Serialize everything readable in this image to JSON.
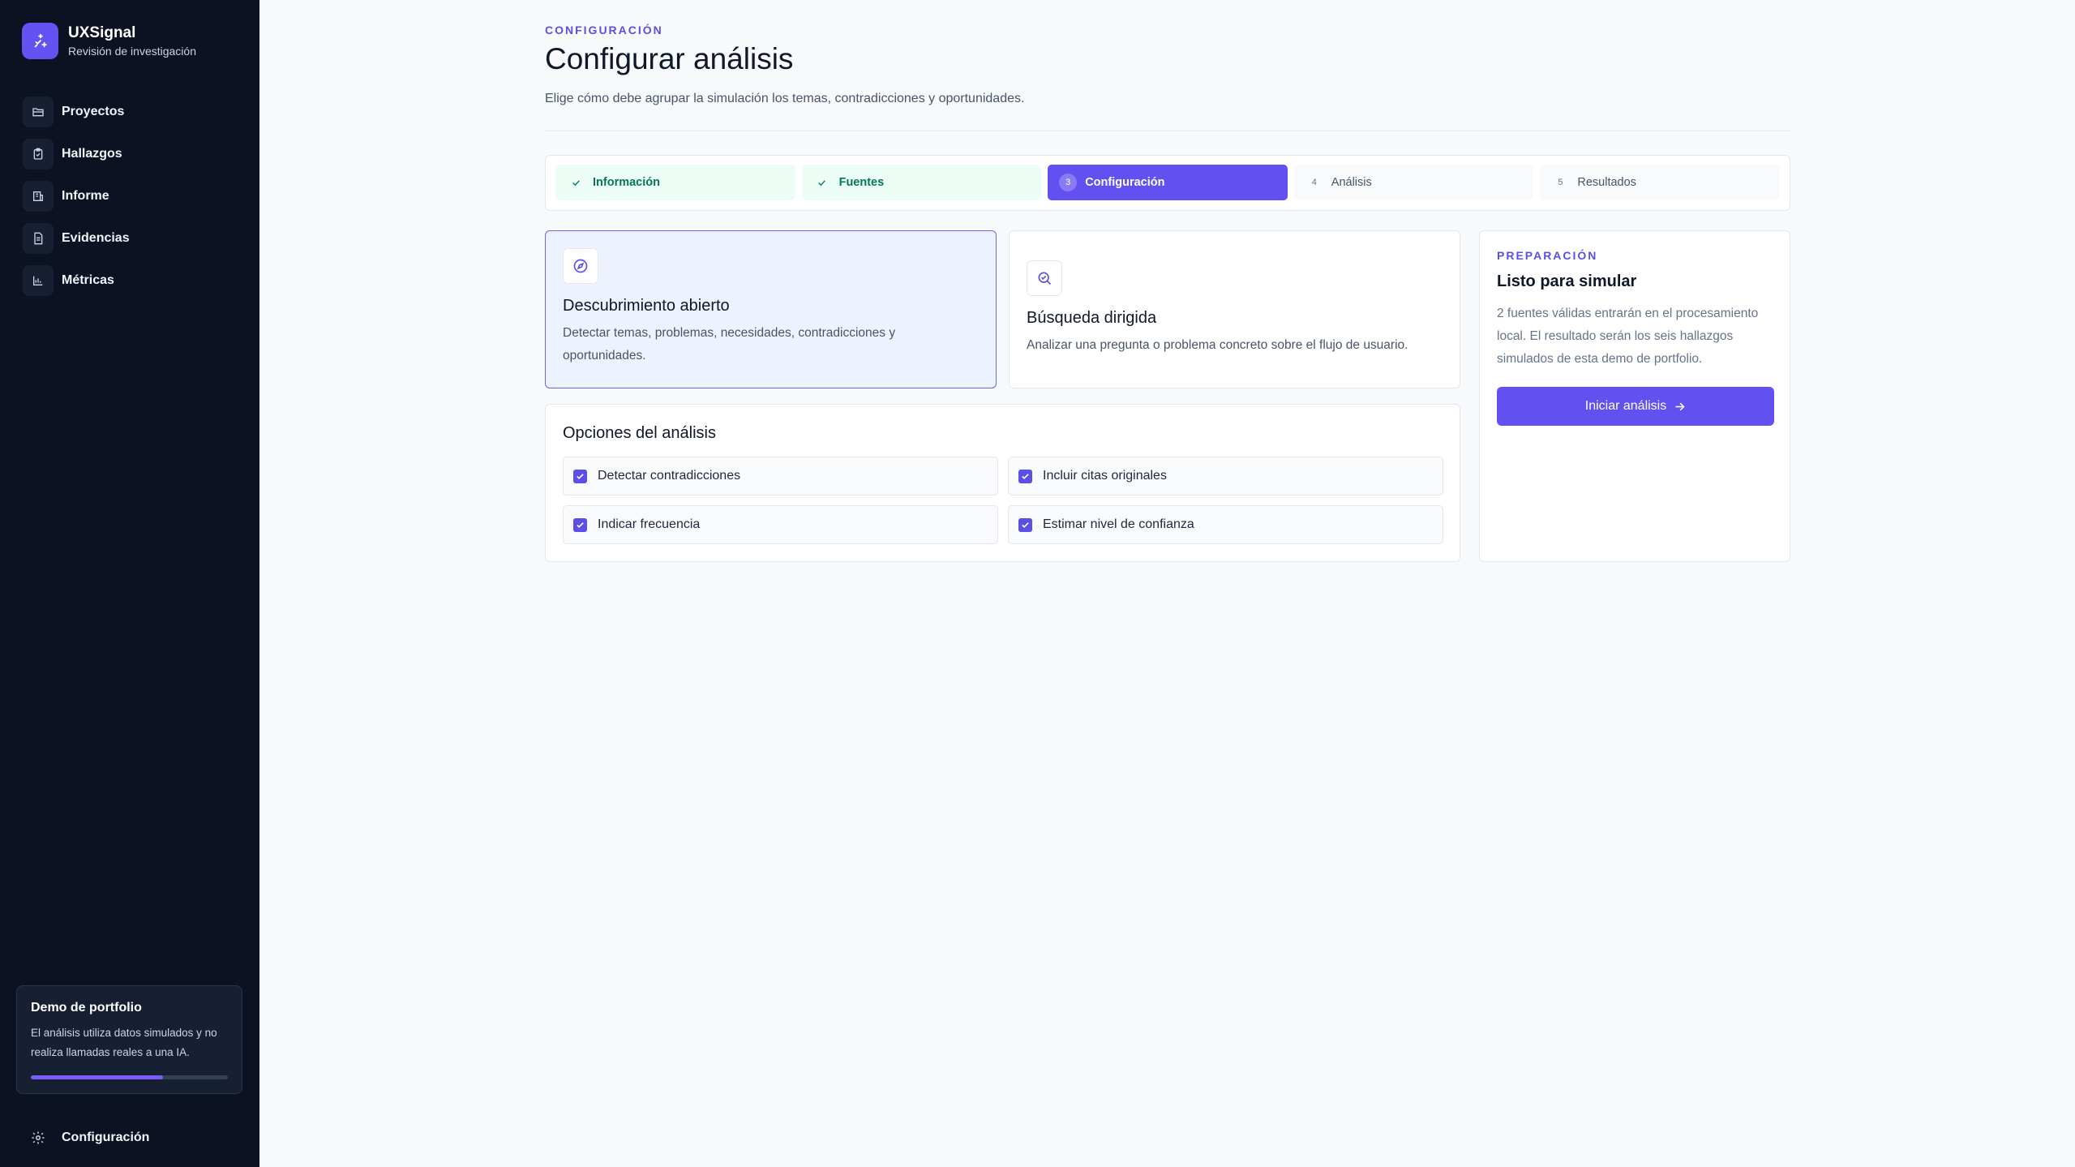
{
  "app": {
    "name": "UXSignal",
    "subtitle": "Revisión de investigación"
  },
  "sidebar": {
    "items": [
      {
        "label": "Proyectos",
        "icon": "folder-icon"
      },
      {
        "label": "Hallazgos",
        "icon": "clipboard-icon"
      },
      {
        "label": "Informe",
        "icon": "report-icon"
      },
      {
        "label": "Evidencias",
        "icon": "document-icon"
      },
      {
        "label": "Métricas",
        "icon": "bar-chart-icon"
      }
    ],
    "demo": {
      "title": "Demo de portfolio",
      "text": "El análisis utiliza datos simulados y no realiza llamadas reales a una IA.",
      "progress": 0.67
    },
    "settings_label": "Configuración"
  },
  "header": {
    "eyebrow": "CONFIGURACIÓN",
    "title": "Configurar análisis",
    "description": "Elige cómo debe agrupar la simulación los temas, contradicciones y oportunidades."
  },
  "stepper": {
    "steps": [
      {
        "label": "Información",
        "status": "done"
      },
      {
        "label": "Fuentes",
        "status": "done"
      },
      {
        "number": "3",
        "label": "Configuración",
        "status": "active"
      },
      {
        "number": "4",
        "label": "Análisis",
        "status": "pending"
      },
      {
        "number": "5",
        "label": "Resultados",
        "status": "pending"
      }
    ]
  },
  "modes": [
    {
      "title": "Descubrimiento abierto",
      "description": "Detectar temas, problemas, necesidades, contradicciones y oportunidades.",
      "icon": "compass-icon",
      "selected": true
    },
    {
      "title": "Búsqueda dirigida",
      "description": "Analizar una pregunta o problema concreto sobre el flujo de usuario.",
      "icon": "search-check-icon",
      "selected": false
    }
  ],
  "options": {
    "title": "Opciones del análisis",
    "items": [
      {
        "label": "Detectar contradicciones",
        "checked": true
      },
      {
        "label": "Incluir citas originales",
        "checked": true
      },
      {
        "label": "Indicar frecuencia",
        "checked": true
      },
      {
        "label": "Estimar nivel de confianza",
        "checked": true
      }
    ]
  },
  "prep": {
    "eyebrow": "PREPARACIÓN",
    "title": "Listo para simular",
    "text": "2 fuentes válidas entrarán en el procesamiento local. El resultado serán los seis hallazgos simulados de esta demo de portfolio.",
    "button_label": "Iniciar análisis"
  },
  "colors": {
    "accent": "#6250f0",
    "sidebar_bg": "#0c1222",
    "done_bg": "#ecfdf5",
    "done_text": "#047857"
  }
}
